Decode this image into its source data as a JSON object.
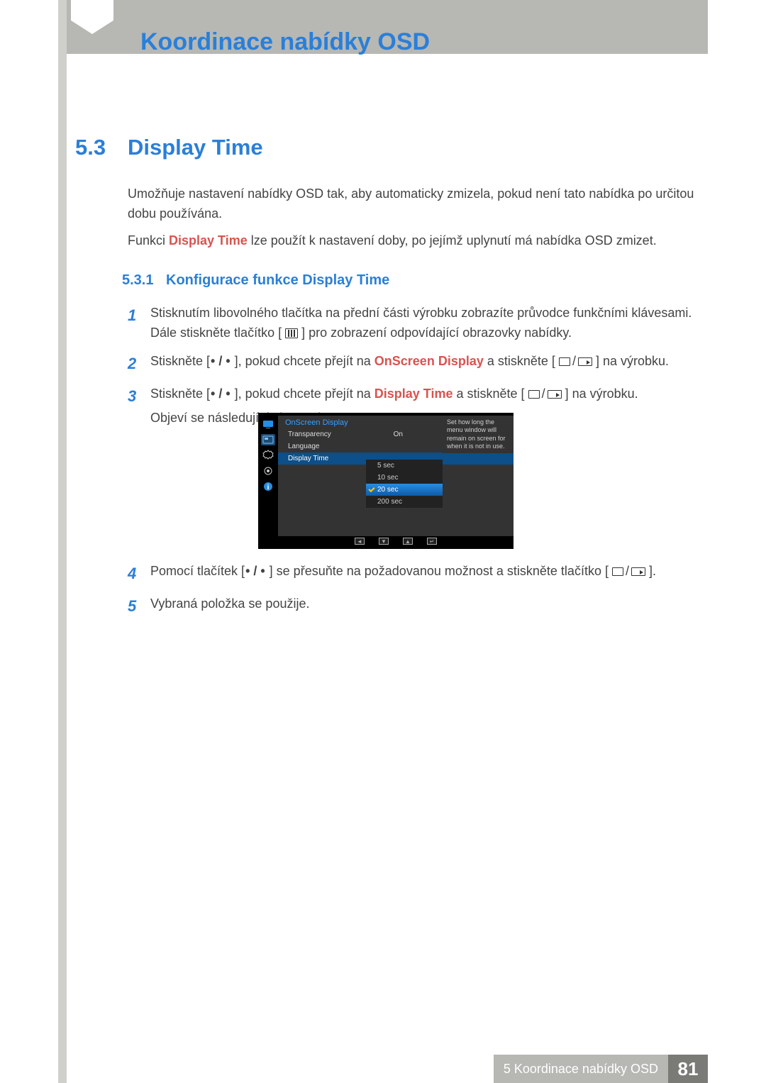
{
  "header": {
    "title": "Koordinace nabídky OSD"
  },
  "section": {
    "number": "5.3",
    "title": "Display Time"
  },
  "para1": "Umožňuje nastavení nabídky OSD tak, aby automaticky zmizela, pokud není tato nabídka po určitou dobu používána.",
  "para2_pre": "Funkci ",
  "para2_hl": "Display Time",
  "para2_post": " lze použít k nastavení doby, po jejímž uplynutí má nabídka OSD zmizet.",
  "subsection": {
    "number": "5.3.1",
    "title": "Konfigurace funkce Display Time"
  },
  "steps": {
    "s1_a": "Stisknutím libovolného tlačítka na přední části výrobku zobrazíte průvodce funkčními klávesami. Dále stiskněte tlačítko [",
    "s1_b": "] pro zobrazení odpovídající obrazovky nabídky.",
    "s2_a": "Stiskněte [",
    "s2_b": " ], pokud chcete přejít na ",
    "s2_hl": "OnScreen Display",
    "s2_c": " a stiskněte [",
    "s2_d": "] na výrobku.",
    "s3_a": "Stiskněte [",
    "s3_b": " ], pokud chcete přejít na ",
    "s3_hl": "Display Time",
    "s3_c": " a stiskněte [",
    "s3_d": "] na výrobku.",
    "s3_e": "Objeví se následující obrazovka.",
    "s4_a": "Pomocí tlačítek [",
    "s4_b": " ] se přesuňte na požadovanou možnost a stiskněte tlačítko [",
    "s4_c": "].",
    "s5": "Vybraná položka se použije.",
    "dot_slash": "• / •"
  },
  "step_numbers": {
    "n1": "1",
    "n2": "2",
    "n3": "3",
    "n4": "4",
    "n5": "5"
  },
  "osd": {
    "heading": "OnScreen Display",
    "rows": [
      {
        "label": "Transparency",
        "value": "On"
      },
      {
        "label": "Language",
        "value": ""
      },
      {
        "label": "Display Time",
        "value": ""
      }
    ],
    "submenu": [
      "5 sec",
      "10 sec",
      "20 sec",
      "200 sec"
    ],
    "selected_submenu_index": 2,
    "tip": "Set how long the menu window will remain on screen for when it is not in use.",
    "nav": [
      "◄",
      "▼",
      "▲",
      "↵"
    ]
  },
  "footer": {
    "label": "5 Koordinace nabídky OSD",
    "page": "81"
  }
}
